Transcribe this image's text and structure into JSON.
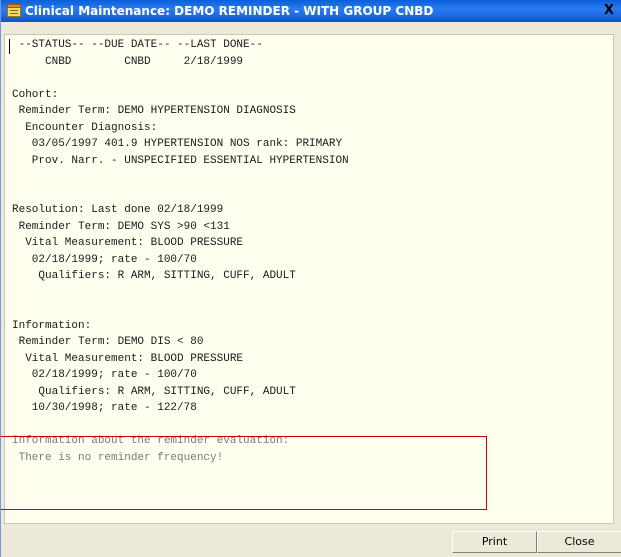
{
  "window": {
    "title": "Clinical Maintenance: DEMO REMINDER - WITH GROUP CNBD",
    "close_symbol": "X"
  },
  "report_lines": [
    " --STATUS-- --DUE DATE-- --LAST DONE--",
    "     CNBD        CNBD     2/18/1999",
    "",
    "Cohort:",
    " Reminder Term: DEMO HYPERTENSION DIAGNOSIS",
    "  Encounter Diagnosis:",
    "   03/05/1997 401.9 HYPERTENSION NOS rank: PRIMARY",
    "   Prov. Narr. - UNSPECIFIED ESSENTIAL HYPERTENSION",
    "",
    "",
    "Resolution: Last done 02/18/1999",
    " Reminder Term: DEMO SYS >90 <131",
    "  Vital Measurement: BLOOD PRESSURE",
    "   02/18/1999; rate - 100/70",
    "    Qualifiers: R ARM, SITTING, CUFF, ADULT",
    "",
    "",
    "Information:",
    " Reminder Term: DEMO DIS < 80",
    "  Vital Measurement: BLOOD PRESSURE",
    "   02/18/1999; rate - 100/70",
    "    Qualifiers: R ARM, SITTING, CUFF, ADULT",
    "   10/30/1998; rate - 122/78",
    "",
    "Information about the reminder evaluation:",
    " There is no reminder frequency!"
  ],
  "buttons": {
    "print": "Print",
    "close": "Close"
  },
  "icons": {
    "title_icon": "clinical-maintenance-icon"
  }
}
